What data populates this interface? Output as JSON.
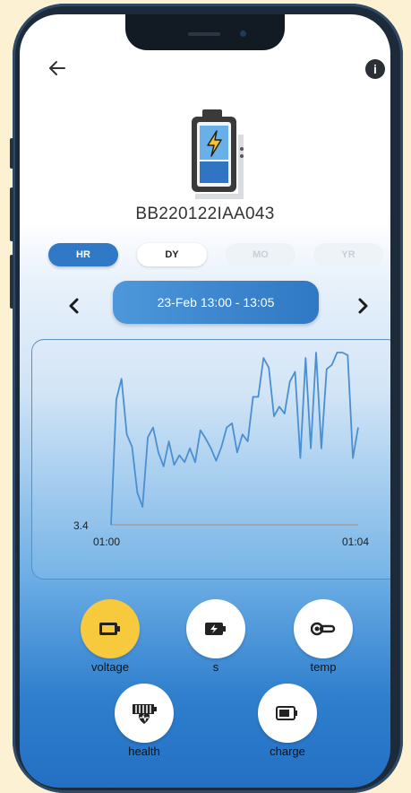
{
  "header": {
    "back_icon": "arrow-left-icon",
    "info_icon": "info-icon",
    "info_glyph": "i"
  },
  "device": {
    "id": "BB220122IAA043",
    "icon": "charging-battery-icon"
  },
  "range_tabs": [
    {
      "label": "HR",
      "active": true
    },
    {
      "label": "DY",
      "active": false
    },
    {
      "label": "MO",
      "active": false
    },
    {
      "label": "YR",
      "active": false
    }
  ],
  "date_nav": {
    "prev_icon": "chevron-left-icon",
    "next_icon": "chevron-right-icon",
    "label": "23-Feb 13:00 - 13:05"
  },
  "chart_data": {
    "type": "line",
    "x_ticks": [
      "01:00",
      "01:04"
    ],
    "y_ticks": [
      "3.4"
    ],
    "series": [
      {
        "values": [
          0.0,
          3.4,
          3.55,
          3.15,
          3.06,
          2.73,
          2.63,
          3.13,
          3.2,
          3.02,
          2.92,
          3.1,
          2.93,
          3.0,
          2.95,
          3.05,
          2.95,
          3.18,
          3.12,
          3.05,
          2.96,
          3.06,
          3.2,
          3.23,
          3.02,
          3.15,
          3.1,
          3.42,
          3.42,
          3.7,
          3.63,
          3.28,
          3.35,
          3.3,
          3.53,
          3.6,
          2.98,
          3.7,
          3.05,
          3.75,
          3.05,
          3.62,
          3.65,
          3.75,
          3.75,
          3.72,
          2.98,
          3.2
        ]
      }
    ],
    "color": "#4a8fd2"
  },
  "metrics": [
    {
      "label": "voltage",
      "icon": "battery-icon",
      "active": true
    },
    {
      "label": "s",
      "icon": "battery-charging-icon",
      "active": false
    },
    {
      "label": "temp",
      "icon": "thermometer-icon",
      "active": false
    },
    {
      "label": "health",
      "icon": "battery-health-icon",
      "active": false
    },
    {
      "label": "charge",
      "icon": "battery-charge-icon",
      "active": false
    }
  ]
}
